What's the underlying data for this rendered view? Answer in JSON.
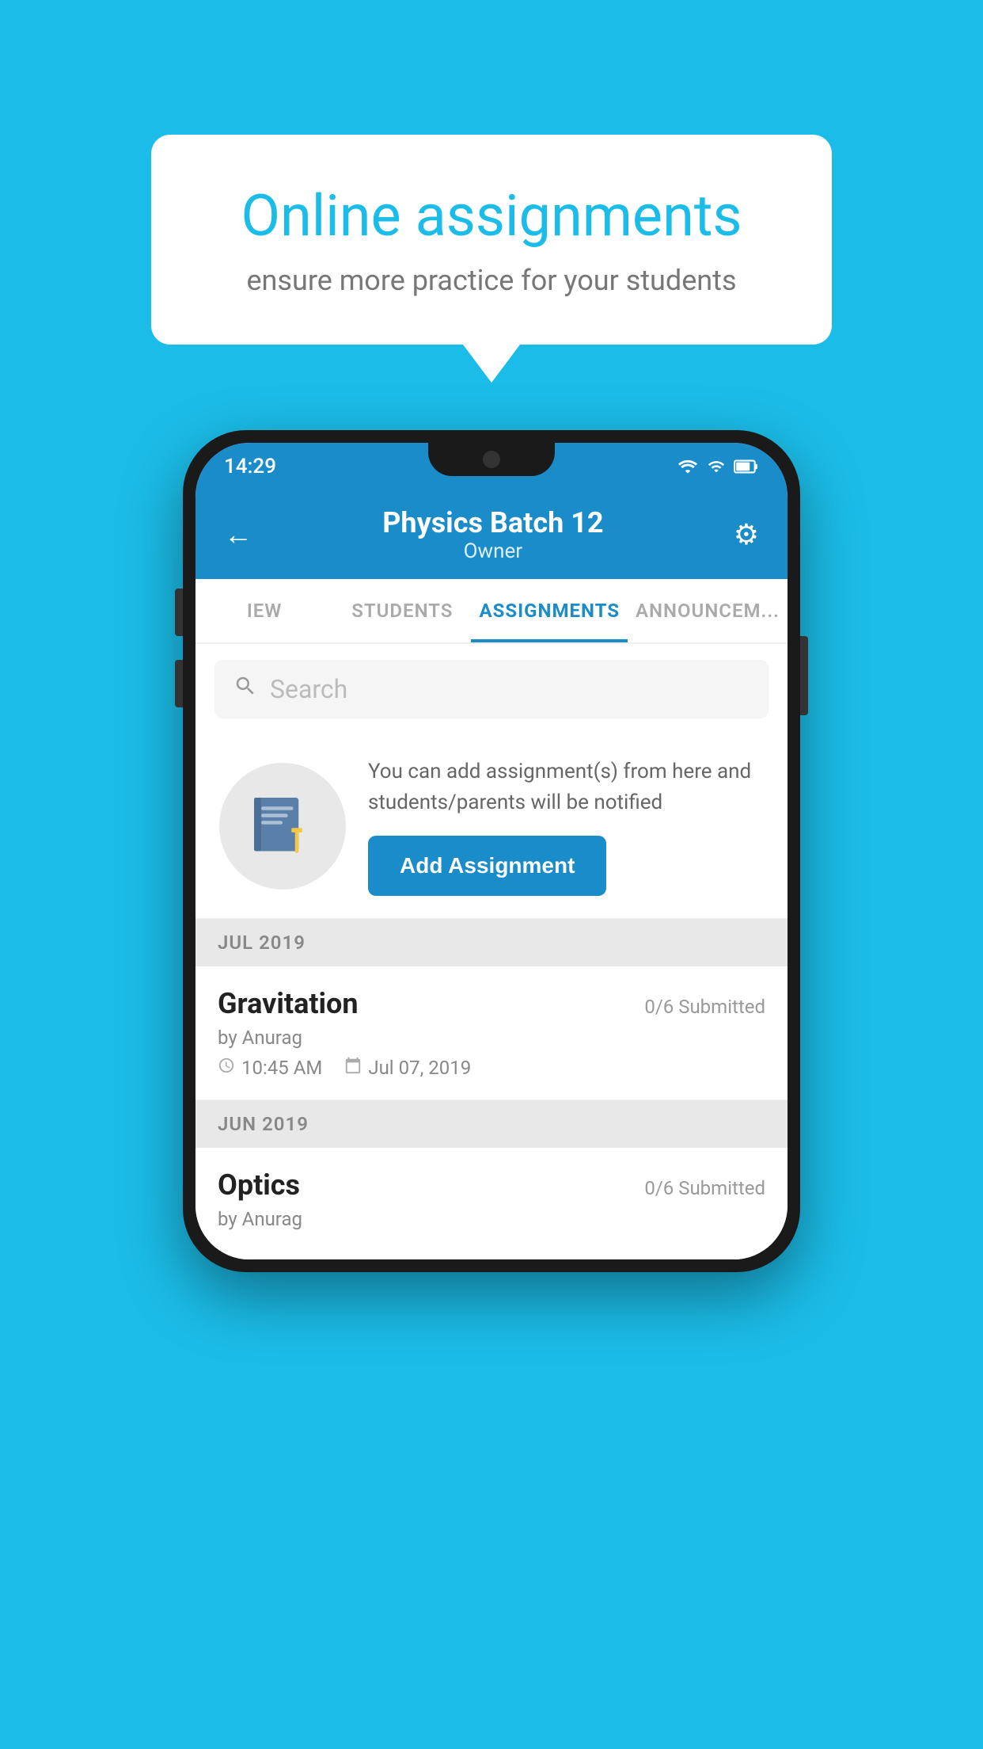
{
  "background": {
    "color": "#1BBDE8"
  },
  "speech_bubble": {
    "title": "Online assignments",
    "subtitle": "ensure more practice for your students"
  },
  "status_bar": {
    "time": "14:29"
  },
  "header": {
    "title": "Physics Batch 12",
    "subtitle": "Owner",
    "back_label": "←",
    "gear_label": "⚙"
  },
  "tabs": [
    {
      "label": "IEW",
      "active": false
    },
    {
      "label": "STUDENTS",
      "active": false
    },
    {
      "label": "ASSIGNMENTS",
      "active": true
    },
    {
      "label": "ANNOUNCEM...",
      "active": false
    }
  ],
  "search": {
    "placeholder": "Search"
  },
  "promo": {
    "text": "You can add assignment(s) from here and students/parents will be notified",
    "button_label": "Add Assignment"
  },
  "sections": [
    {
      "label": "JUL 2019",
      "assignments": [
        {
          "name": "Gravitation",
          "submitted": "0/6 Submitted",
          "by": "by Anurag",
          "time": "10:45 AM",
          "date": "Jul 07, 2019"
        }
      ]
    },
    {
      "label": "JUN 2019",
      "assignments": [
        {
          "name": "Optics",
          "submitted": "0/6 Submitted",
          "by": "by Anurag",
          "time": "",
          "date": ""
        }
      ]
    }
  ]
}
